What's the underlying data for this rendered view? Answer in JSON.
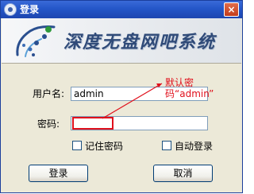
{
  "window": {
    "title": "登录",
    "close_label": "×"
  },
  "banner": {
    "brand_text": "深度无盘网吧系统"
  },
  "form": {
    "username_label": "用户名:",
    "username_value": "admin",
    "password_label": "密码:",
    "password_value": ""
  },
  "annotation": {
    "text": "默认密码“admin”"
  },
  "options": {
    "remember_label": "记住密码",
    "remember_checked": false,
    "autologin_label": "自动登录",
    "autologin_checked": false
  },
  "buttons": {
    "login_label": "登录",
    "cancel_label": "取消"
  },
  "colors": {
    "titlebar": "#2456c8",
    "annotation": "#e0101c",
    "brand": "#2f4a78"
  }
}
